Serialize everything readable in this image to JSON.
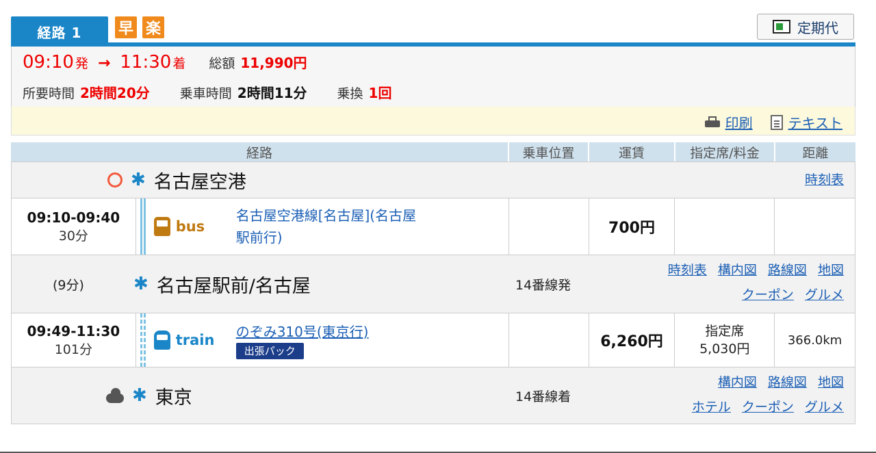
{
  "tabs": {
    "route_label": "経路 1",
    "badge_fast": "早",
    "badge_easy": "楽",
    "commuter_label": "定期代"
  },
  "summary": {
    "depart_time": "09:10",
    "depart_suffix": "発",
    "arrow": "→",
    "arrive_time": "11:30",
    "arrive_suffix": "着",
    "total_label": "総額",
    "total_value": "11,990円",
    "required_label": "所要時間",
    "required_value": "2時間20分",
    "ride_label": "乗車時間",
    "ride_value": "2時間11分",
    "transfer_label": "乗換",
    "transfer_value": "1回"
  },
  "actions": {
    "print": "印刷",
    "text": "テキスト"
  },
  "table_headers": {
    "route": "経路",
    "position": "乗車位置",
    "fare": "運賃",
    "seat": "指定席/料金",
    "distance": "距離"
  },
  "station1": {
    "name": "名古屋空港",
    "weather": "sun-icon",
    "links": [
      "時刻表"
    ]
  },
  "segment1": {
    "time_range": "09:10-09:40",
    "duration": "30分",
    "mode_icon": "bus-icon",
    "mode_label": "bus",
    "line_name_1": "名古屋空港線[名古屋](名古屋",
    "line_name_2": "駅前行)",
    "fare": "700円"
  },
  "station2": {
    "wait": "(9分)",
    "name": "名古屋駅前/名古屋",
    "track": "14番線発",
    "links_row1": [
      "時刻表",
      "構内図",
      "路線図",
      "地図"
    ],
    "links_row2": [
      "クーポン",
      "グルメ"
    ]
  },
  "segment2": {
    "time_range": "09:49-11:30",
    "duration": "101分",
    "mode_icon": "train-icon",
    "mode_label": "train",
    "line_name": "のぞみ310号(東京行)",
    "pack_label": "出張パック",
    "fare": "6,260円",
    "seat_label": "指定席",
    "seat_price": "5,030円",
    "distance": "366.0km"
  },
  "station3": {
    "name": "東京",
    "weather": "cloud-icon",
    "track": "14番線着",
    "links_row1": [
      "構内図",
      "路線図",
      "地図"
    ],
    "links_row2": [
      "ホテル",
      "クーポン",
      "グルメ"
    ]
  },
  "colors": {
    "accent": "#1a86c8",
    "highlight": "#ee0000",
    "badge": "#f08a1c"
  }
}
